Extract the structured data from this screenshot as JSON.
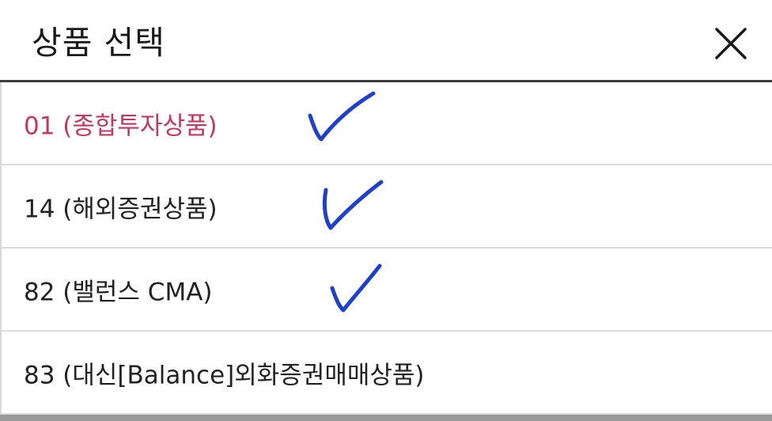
{
  "dialog": {
    "title": "상품 선택",
    "close_icon": "close-x-icon"
  },
  "products": [
    {
      "label": "01 (종합투자상품)",
      "selected": true,
      "checked": true
    },
    {
      "label": "14 (해외증권상품)",
      "selected": false,
      "checked": true
    },
    {
      "label": "82 (밸런스 CMA)",
      "selected": false,
      "checked": true
    },
    {
      "label": "83 (대신[Balance]외화증권매매상품)",
      "selected": false,
      "checked": false
    }
  ],
  "colors": {
    "selected_text": "#c2395d",
    "text": "#222222",
    "check_mark": "#1f3fcf",
    "divider": "#dcdcdc"
  }
}
